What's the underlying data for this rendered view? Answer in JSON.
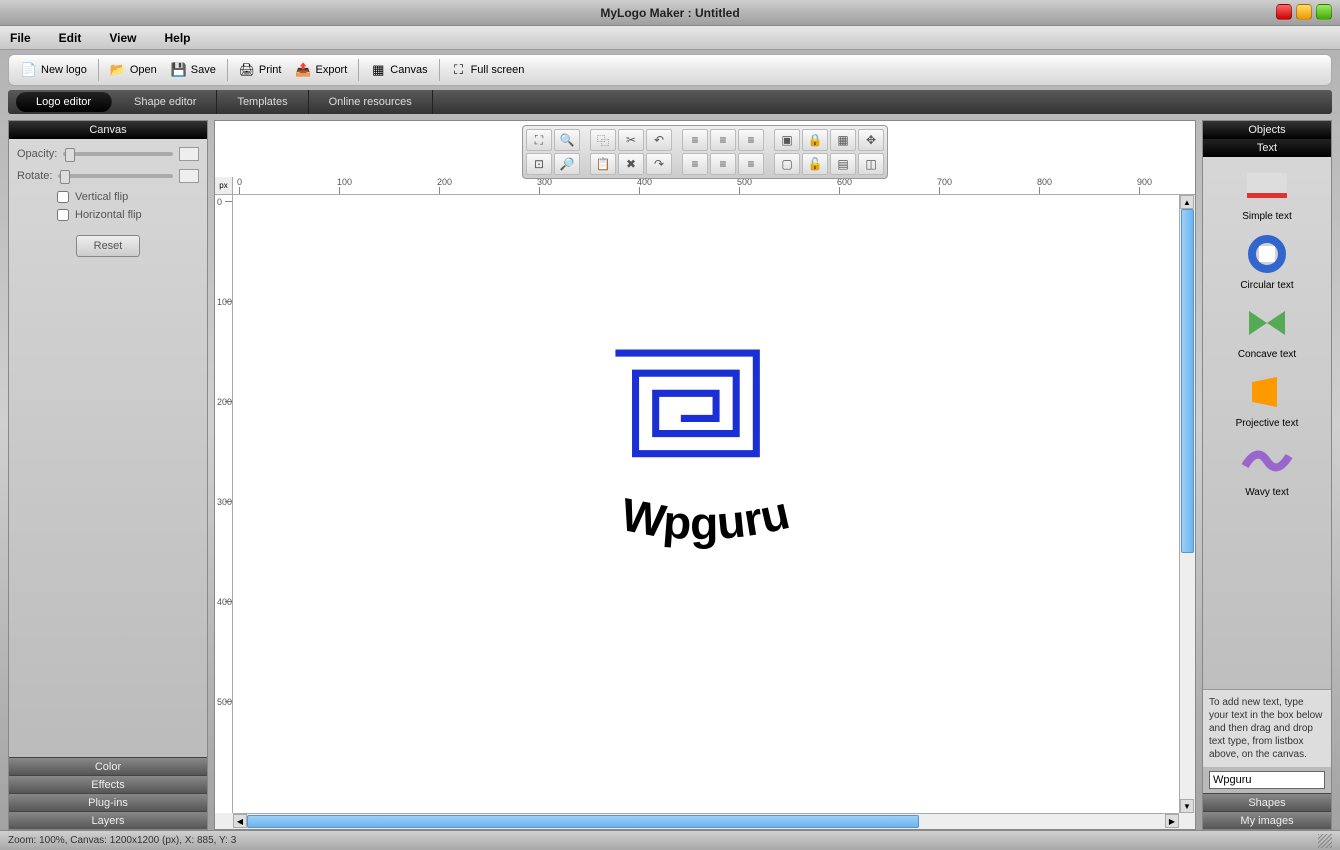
{
  "app": {
    "title": "MyLogo Maker : Untitled"
  },
  "menu": {
    "file": "File",
    "edit": "Edit",
    "view": "View",
    "help": "Help"
  },
  "toolbar": {
    "newlogo": "New logo",
    "open": "Open",
    "save": "Save",
    "print": "Print",
    "export": "Export",
    "canvas": "Canvas",
    "fullscreen": "Full screen"
  },
  "tabs": {
    "logo_editor": "Logo editor",
    "shape_editor": "Shape editor",
    "templates": "Templates",
    "online": "Online resources"
  },
  "left": {
    "header": "Canvas",
    "opacity_label": "Opacity:",
    "rotate_label": "Rotate:",
    "vflip": "Vertical flip",
    "hflip": "Horizontal flip",
    "reset": "Reset",
    "acc_color": "Color",
    "acc_effects": "Effects",
    "acc_plugins": "Plug-ins",
    "acc_layers": "Layers"
  },
  "right": {
    "header_objects": "Objects",
    "header_text": "Text",
    "items": {
      "simple": "Simple text",
      "circular": "Circular text",
      "concave": "Concave text",
      "projective": "Projective text",
      "wavy": "Wavy text"
    },
    "hint": "To add new text, type your text in the box below and then drag and drop text type, from listbox above, on the canvas.",
    "input_value": "Wpguru",
    "acc_shapes": "Shapes",
    "acc_myimages": "My images"
  },
  "ruler": {
    "unit": "px",
    "hticks": [
      0,
      100,
      200,
      300,
      400,
      500,
      600,
      700,
      800,
      900
    ],
    "vticks": [
      0,
      100,
      200,
      300,
      400,
      500
    ]
  },
  "canvas_content": {
    "text": "Wpguru"
  },
  "status": {
    "text": "Zoom: 100%, Canvas: 1200x1200 (px), X: 885, Y: 3"
  }
}
